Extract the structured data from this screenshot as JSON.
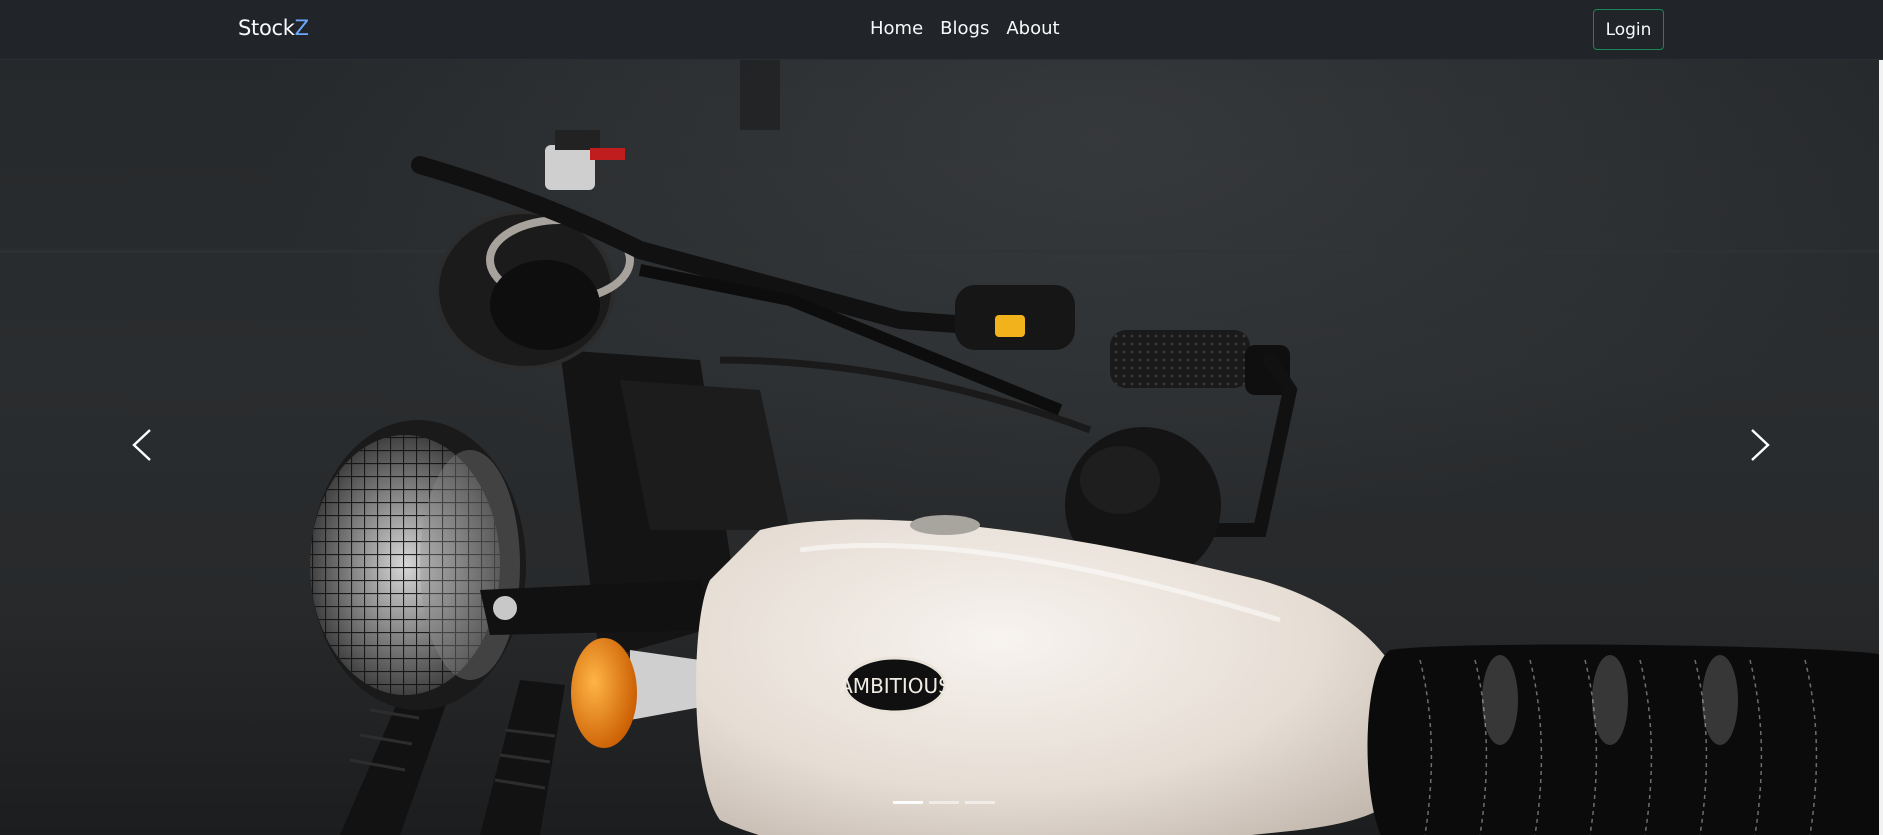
{
  "nav": {
    "brand_main": "Stock",
    "brand_accent": "Z",
    "links": [
      "Home",
      "Blogs",
      "About"
    ],
    "login_label": "Login"
  },
  "hero": {
    "image_subject": "motorcycle",
    "tank_badge_text": "AMBITIOUS",
    "slide_count": 3,
    "active_slide": 1
  },
  "controls": {
    "prev_icon": "chevron-left-icon",
    "next_icon": "chevron-right-icon"
  },
  "colors": {
    "navbar_bg": "#212529",
    "login_border": "#198754",
    "brand_accent": "#6ea8fe"
  }
}
